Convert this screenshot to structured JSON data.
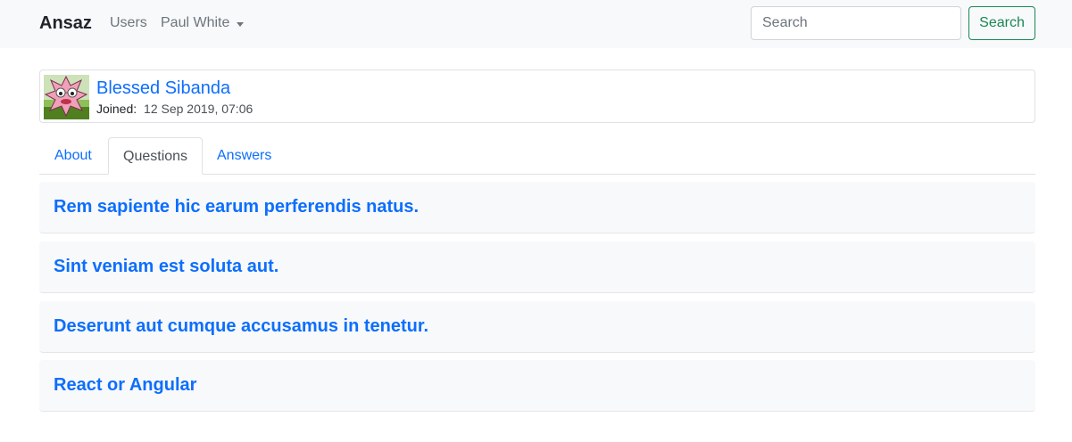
{
  "navbar": {
    "brand": "Ansaz",
    "users_label": "Users",
    "user_menu_label": "Paul White",
    "search_placeholder": "Search",
    "search_button": "Search"
  },
  "profile": {
    "name": "Blessed Sibanda",
    "joined_label": "Joined:",
    "joined_date": "12 Sep 2019, 07:06"
  },
  "tabs": [
    {
      "label": "About",
      "active": false
    },
    {
      "label": "Questions",
      "active": true
    },
    {
      "label": "Answers",
      "active": false
    }
  ],
  "questions": [
    {
      "title": "Rem sapiente hic earum perferendis natus."
    },
    {
      "title": "Sint veniam est soluta aut."
    },
    {
      "title": "Deserunt aut cumque accusamus in tenetur."
    },
    {
      "title": "React or Angular"
    }
  ],
  "colors": {
    "link": "#0d6efd",
    "success": "#198754",
    "navbar_bg": "#f8f9fa"
  },
  "icons": {
    "avatar": "identicon-avatar",
    "dropdown": "caret-down-icon"
  }
}
